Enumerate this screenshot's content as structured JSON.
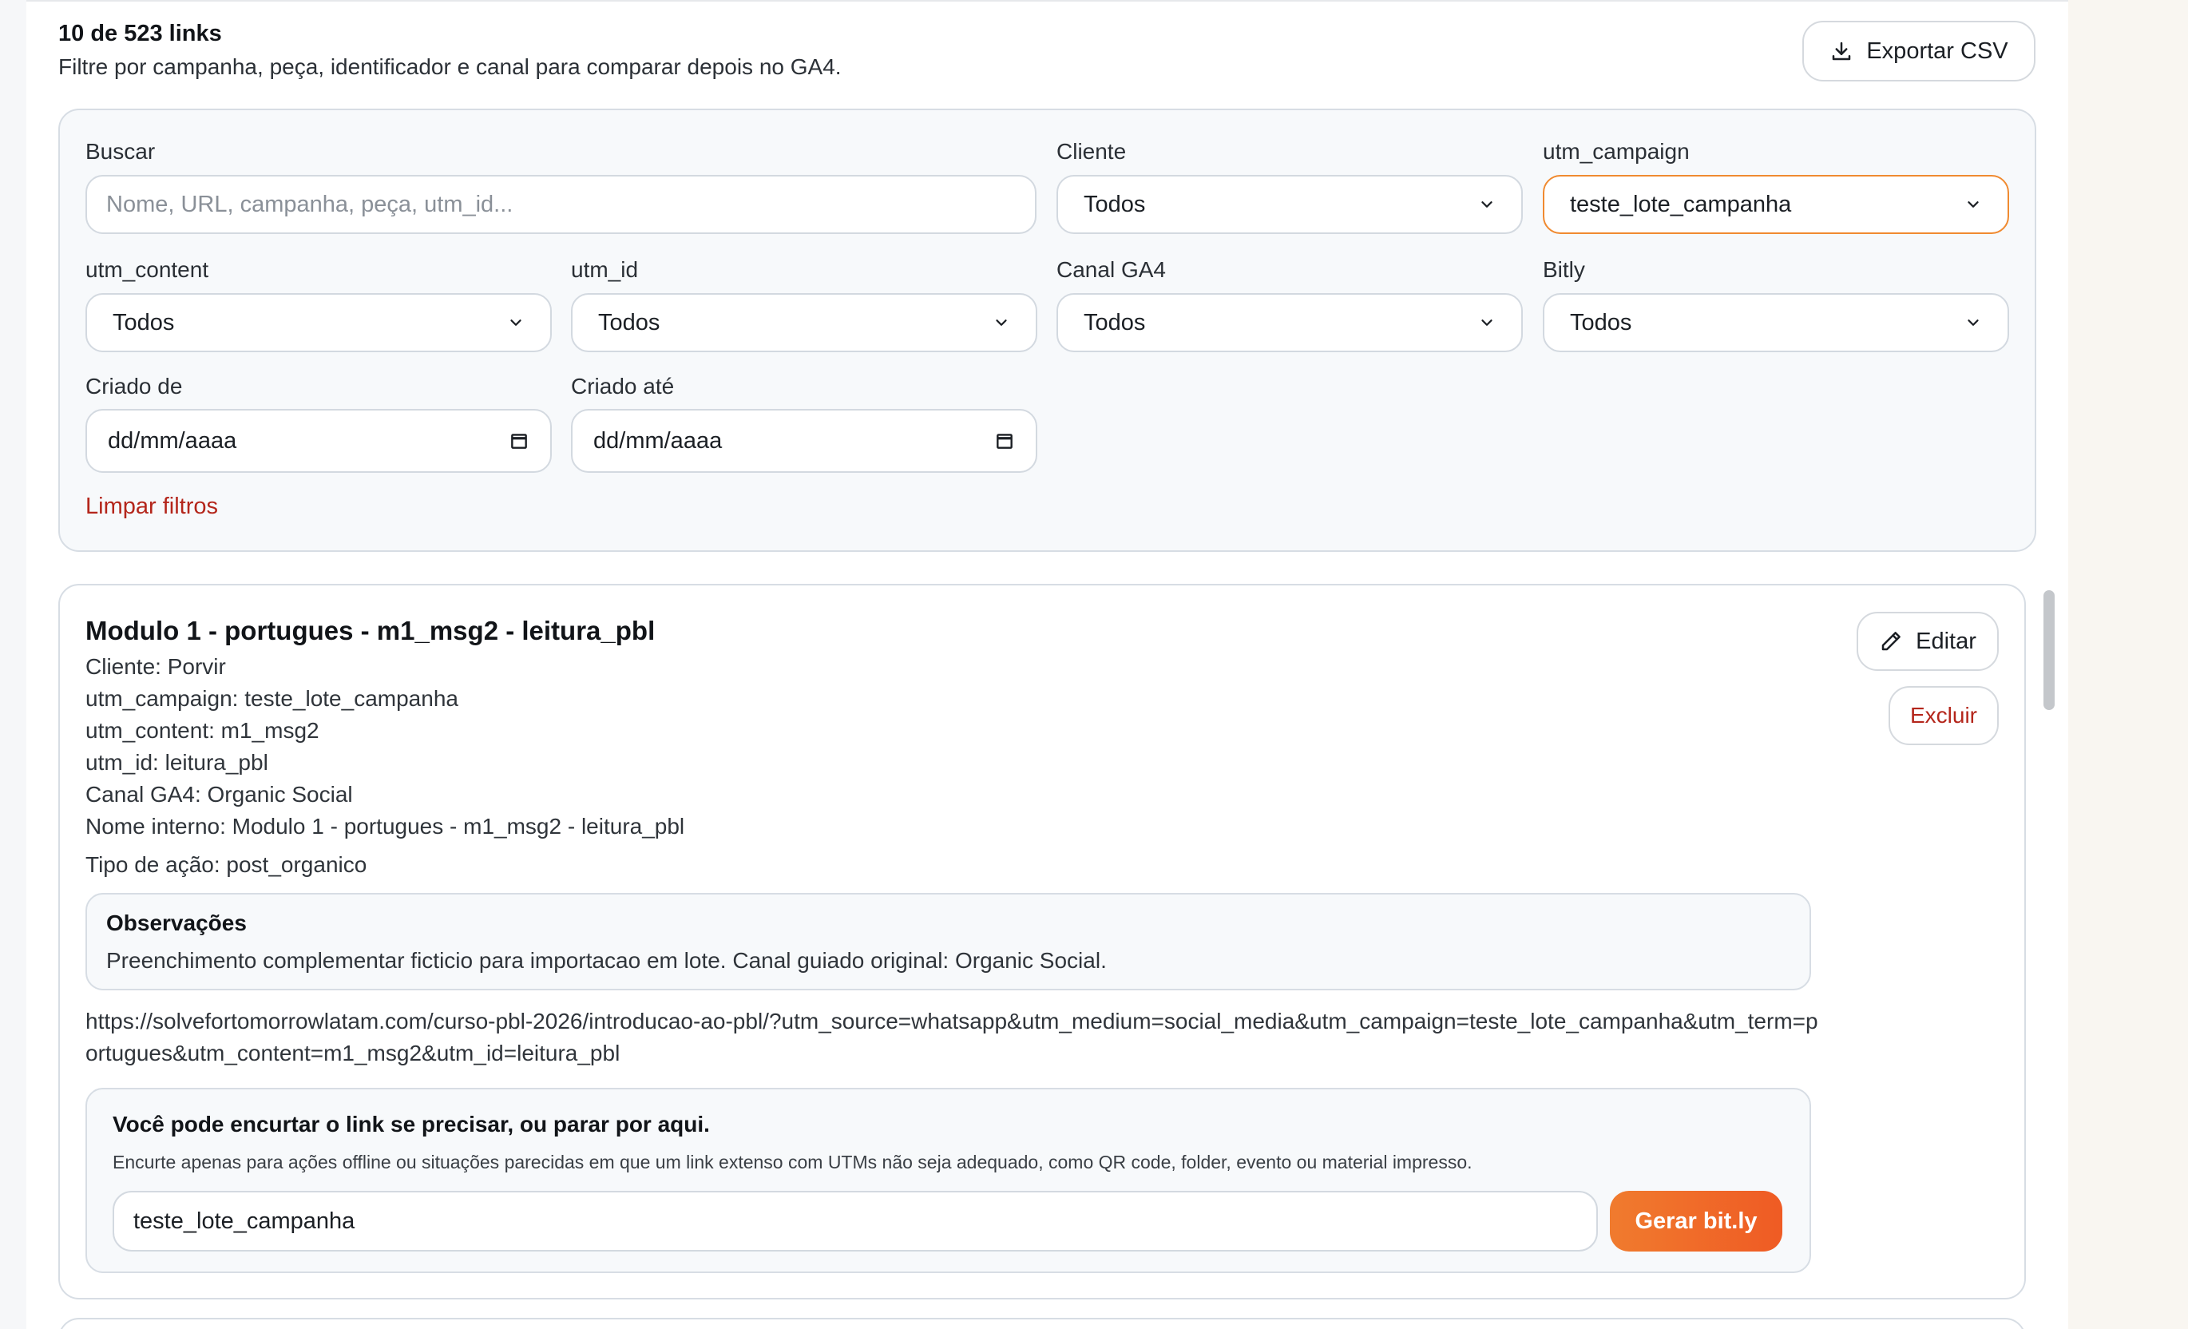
{
  "header": {
    "count_text": "10 de 523 links",
    "subtitle": "Filtre por campanha, peça, identificador e canal para comparar depois no GA4.",
    "export_label": "Exportar CSV",
    "export_icon": "download-icon"
  },
  "filters": {
    "search": {
      "label": "Buscar",
      "placeholder": "Nome, URL, campanha, peça, utm_id..."
    },
    "cliente": {
      "label": "Cliente",
      "value": "Todos"
    },
    "utm_campaign": {
      "label": "utm_campaign",
      "value": "teste_lote_campanha"
    },
    "utm_content": {
      "label": "utm_content",
      "value": "Todos"
    },
    "utm_id": {
      "label": "utm_id",
      "value": "Todos"
    },
    "canal_ga4": {
      "label": "Canal GA4",
      "value": "Todos"
    },
    "bitly": {
      "label": "Bitly",
      "value": "Todos"
    },
    "criado_de": {
      "label": "Criado de",
      "value": "dd/mm/aaaa"
    },
    "criado_ate": {
      "label": "Criado até",
      "value": "dd/mm/aaaa"
    },
    "clear_label": "Limpar filtros",
    "active_color": "#f08a30"
  },
  "card": {
    "title": "Modulo 1 - portugues - m1_msg2 - leitura_pbl",
    "cliente": "Cliente: Porvir",
    "utm_campaign": "utm_campaign: teste_lote_campanha",
    "utm_content": "utm_content: m1_msg2",
    "utm_id": "utm_id: leitura_pbl",
    "canal": "Canal GA4: Organic Social",
    "nome_interno": "Nome interno: Modulo 1 - portugues - m1_msg2 - leitura_pbl",
    "tipo_acao": "Tipo de ação: post_organico",
    "edit_label": "Editar",
    "edit_icon": "pencil-icon",
    "delete_label": "Excluir",
    "notes_title": "Observações",
    "notes_text": "Preenchimento complementar ficticio para importacao em lote. Canal guiado original: Organic Social.",
    "url": "https://solvefortomorrowlatam.com/curso-pbl-2026/introducao-ao-pbl/?utm_source=whatsapp&utm_medium=social_media&utm_campaign=teste_lote_campanha&utm_term=portugues&utm_content=m1_msg2&utm_id=leitura_pbl",
    "shorten_title": "Você pode encurtar o link se precisar, ou parar por aqui.",
    "shorten_desc": "Encurte apenas para ações offline ou situações parecidas em que um link extenso com UTMs não seja adequado, como QR code, folder, evento ou material impresso.",
    "shorten_input_value": "teste_lote_campanha",
    "bitly_label": "Gerar bit.ly",
    "accent_color": "#ef5b24",
    "danger_color": "#b4261b"
  }
}
